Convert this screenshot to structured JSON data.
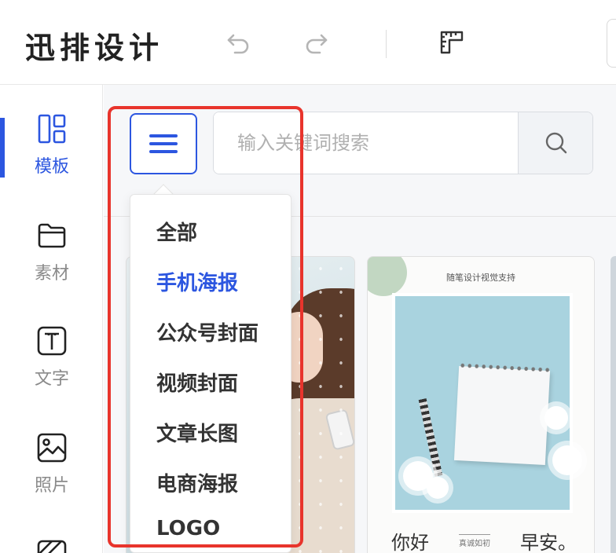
{
  "header": {
    "logo_text": "迅排设计",
    "buttons": [
      "undo-icon",
      "redo-icon",
      "ruler-icon"
    ]
  },
  "sidebar": {
    "items": [
      {
        "label": "模板",
        "icon": "layout-grid-icon",
        "active": true
      },
      {
        "label": "素材",
        "icon": "folder-icon",
        "active": false
      },
      {
        "label": "文字",
        "icon": "text-icon",
        "active": false
      },
      {
        "label": "照片",
        "icon": "image-icon",
        "active": false
      }
    ]
  },
  "search": {
    "placeholder": "输入关键词搜索",
    "value": ""
  },
  "category_menu": {
    "items": [
      {
        "label": "全部",
        "active": false
      },
      {
        "label": "手机海报",
        "active": true
      },
      {
        "label": "公众号封面",
        "active": false
      },
      {
        "label": "视频封面",
        "active": false
      },
      {
        "label": "文章长图",
        "active": false
      },
      {
        "label": "电商海报",
        "active": false
      },
      {
        "label": "LOGO",
        "active": false
      }
    ]
  },
  "templates": {
    "card2": {
      "caption": "随笔设计视觉支持",
      "greeting_left": "你好",
      "greeting_mid": "真诚如初",
      "greeting_right": "早安。"
    }
  },
  "colors": {
    "accent": "#2c56e0",
    "highlight": "#e8342c"
  }
}
